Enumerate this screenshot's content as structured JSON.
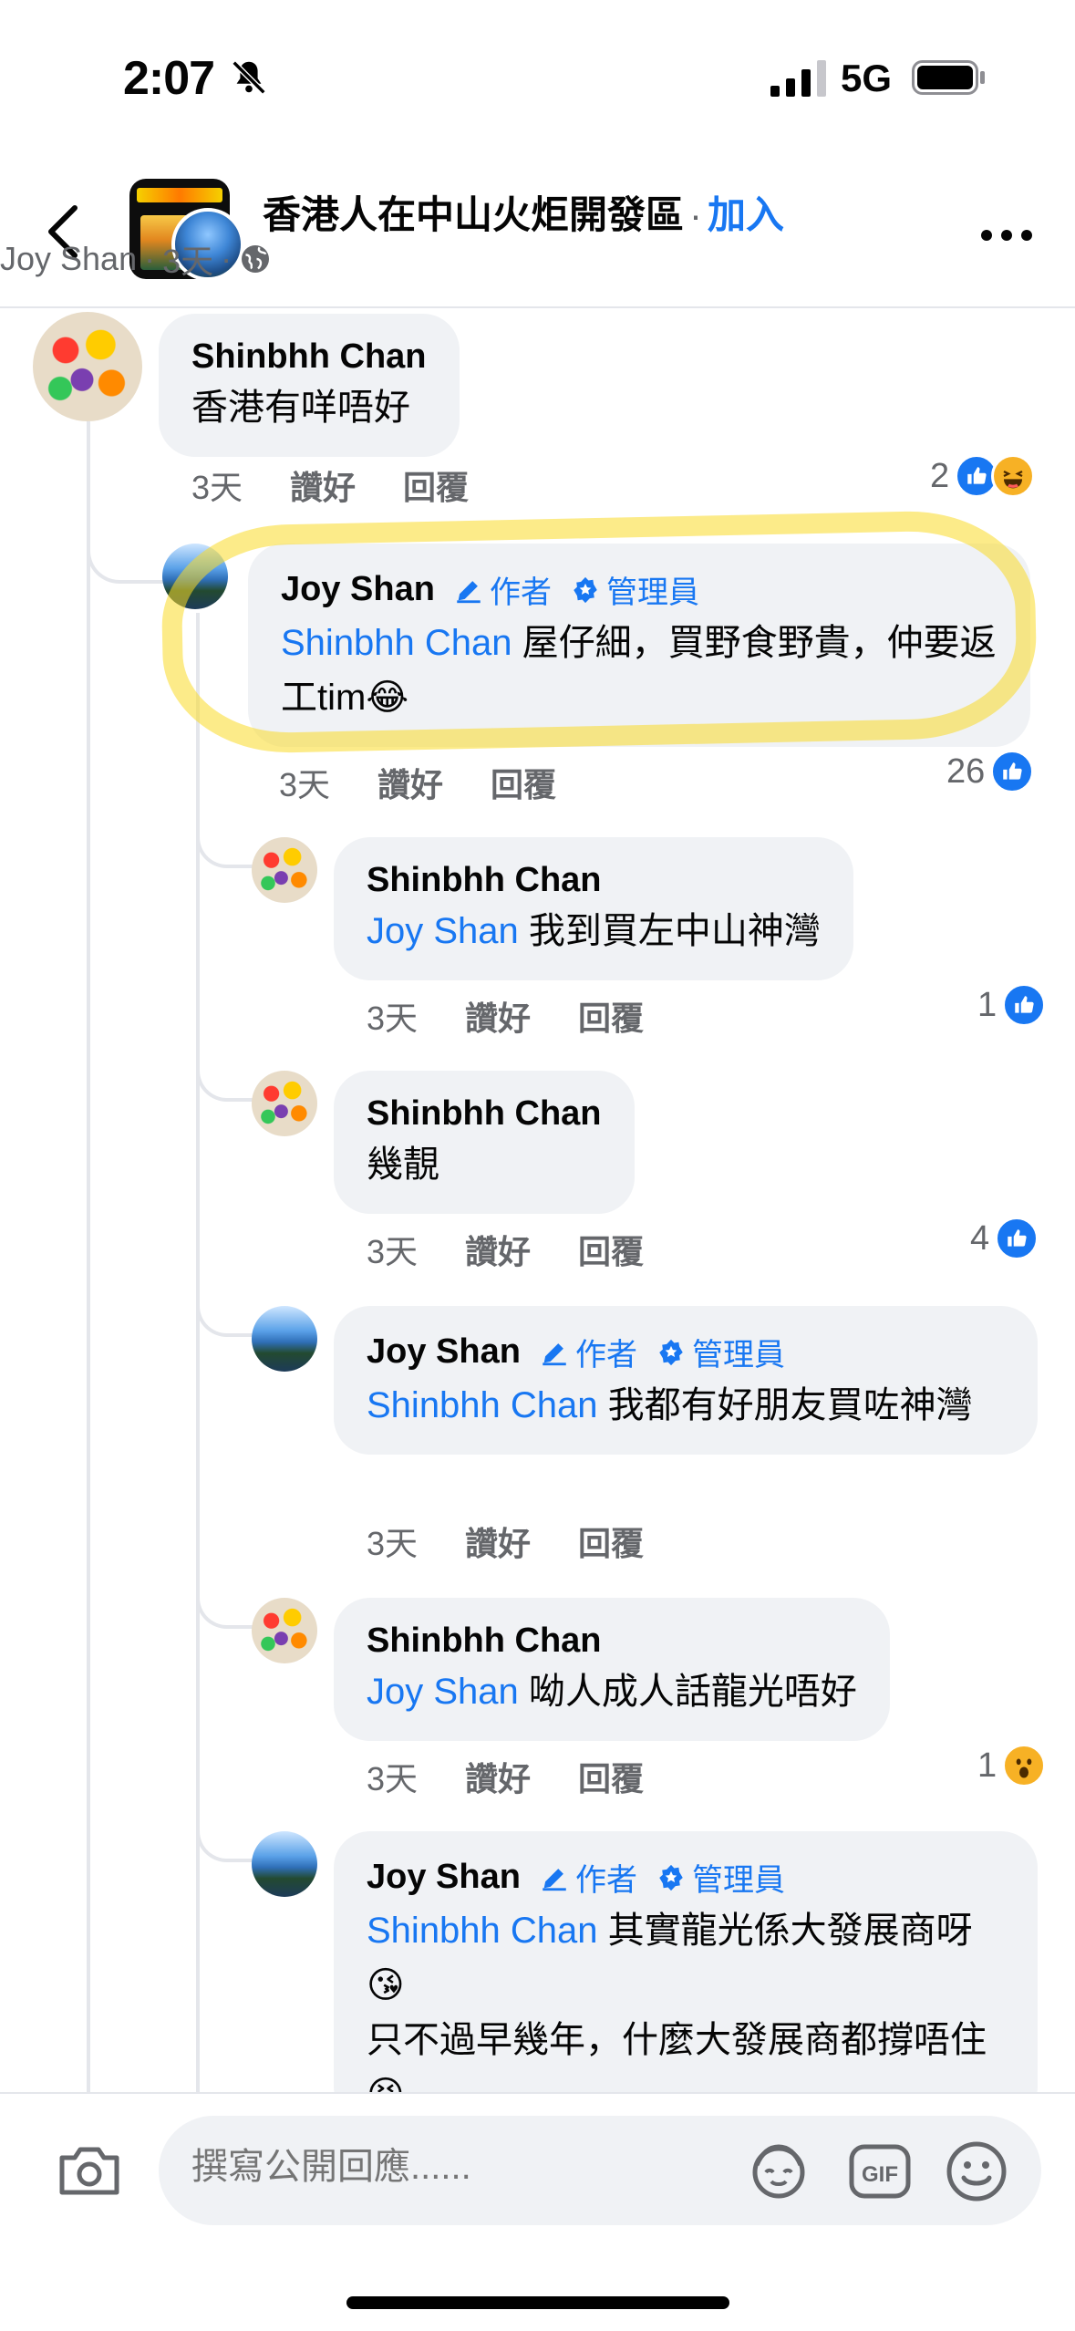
{
  "status_bar": {
    "time": "2:07",
    "network": "5G"
  },
  "header": {
    "group_name": "香港人在中山火炬開發區",
    "separator": "·",
    "join_label": "加入",
    "author": "Joy Shan",
    "age": "3天",
    "meta_sep": "·"
  },
  "labels": {
    "author_badge": "作者",
    "admin_badge": "管理員",
    "like": "讚好",
    "reply": "回覆"
  },
  "comments": [
    {
      "author": "Shinbhh Chan",
      "mention": "",
      "text": "香港有咩唔好",
      "time": "3天",
      "reaction_count": "2",
      "reactions": [
        "like-icon",
        "haha-icon"
      ]
    },
    {
      "author": "Joy Shan",
      "mention": "Shinbhh Chan",
      "text": " 屋仔細，買野食野貴，仲要返工tim😂",
      "time": "3天",
      "reaction_count": "26",
      "reactions": [
        "like-icon"
      ]
    },
    {
      "author": "Shinbhh Chan",
      "mention": "Joy Shan",
      "text": " 我到買左中山神灣",
      "time": "3天",
      "reaction_count": "1",
      "reactions": [
        "like-icon"
      ]
    },
    {
      "author": "Shinbhh Chan",
      "mention": "",
      "text": "幾靚",
      "time": "3天",
      "reaction_count": "4",
      "reactions": [
        "like-icon"
      ]
    },
    {
      "author": "Joy Shan",
      "mention": "Shinbhh Chan",
      "text": " 我都有好朋友買咗神灣",
      "time": "3天",
      "reaction_count": "",
      "reactions": []
    },
    {
      "author": "Shinbhh Chan",
      "mention": "Joy Shan",
      "text": " 呦人成人話龍光唔好",
      "time": "3天",
      "reaction_count": "1",
      "reactions": [
        "wow-icon"
      ]
    },
    {
      "author": "Joy Shan",
      "mention": "Shinbhh Chan",
      "text": " 其實龍光係大發展商呀😘",
      "text2": "只不過早幾年，什麼大發展商都撐唔住😣",
      "time": "",
      "reaction_count": "",
      "reactions": []
    }
  ],
  "composer": {
    "placeholder": "撰寫公開回應......"
  },
  "colors": {
    "accent": "#1877f2",
    "bubble": "#f0f2f5",
    "secondary_text": "#65676b",
    "highlight": "#fadb28"
  }
}
